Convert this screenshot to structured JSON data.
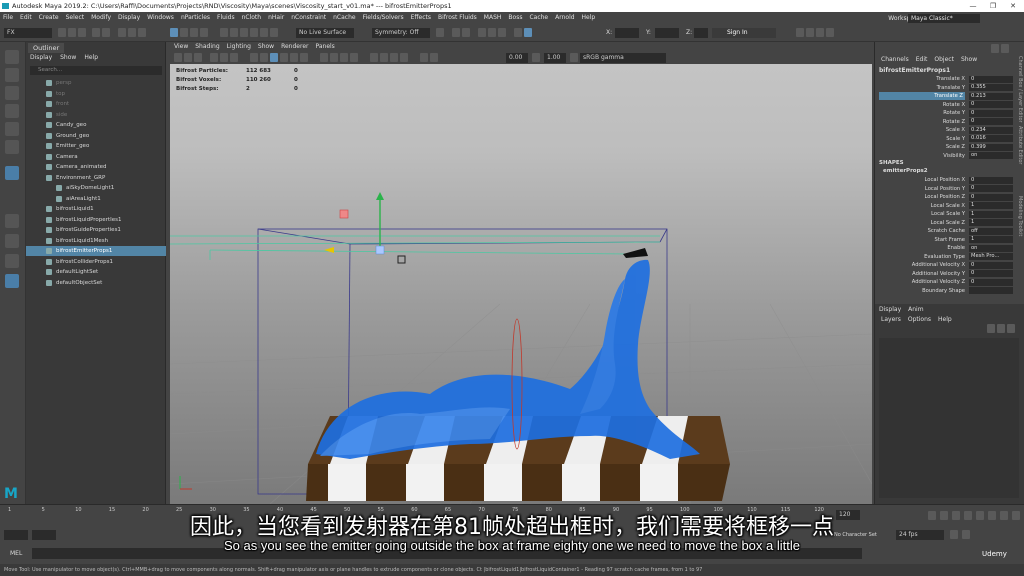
{
  "window": {
    "title": "Autodesk Maya 2019.2: C:\\Users\\Raffi\\Documents\\Projects\\RND\\Viscosity\\Maya\\scenes\\Viscosity_start_v01.ma*    ---    bifrostEmitterProps1"
  },
  "menu": [
    "File",
    "Edit",
    "Create",
    "Select",
    "Modify",
    "Display",
    "Windows",
    "nParticles",
    "Fluids",
    "nCloth",
    "nHair",
    "nConstraint",
    "nCache",
    "Fields/Solvers",
    "Effects",
    "Bifrost Fluids",
    "MASH",
    "Boss",
    "Cache",
    "Arnold",
    "Help"
  ],
  "workspace": {
    "label": "Workspace :",
    "value": "Maya Classic*"
  },
  "status": {
    "mode": "FX",
    "live_surface": "No Live Surface",
    "symmetry": "Symmetry: Off",
    "x": "X:",
    "y": "Y:",
    "z": "Z:",
    "signin": "Sign In"
  },
  "outliner": {
    "tab": "Outliner",
    "menu": [
      "Display",
      "Show",
      "Help"
    ],
    "search": "Search...",
    "items": [
      {
        "label": "persp",
        "dim": true,
        "indent": 0
      },
      {
        "label": "top",
        "dim": true,
        "indent": 0
      },
      {
        "label": "front",
        "dim": true,
        "indent": 0
      },
      {
        "label": "side",
        "dim": true,
        "indent": 0
      },
      {
        "label": "Candy_geo",
        "indent": 0
      },
      {
        "label": "Ground_geo",
        "indent": 0
      },
      {
        "label": "Emitter_geo",
        "indent": 0
      },
      {
        "label": "Camera",
        "indent": 0
      },
      {
        "label": "Camera_animated",
        "indent": 0
      },
      {
        "label": "Environment_GRP",
        "indent": 0
      },
      {
        "label": "aiSkyDomeLight1",
        "indent": 1
      },
      {
        "label": "aiAreaLight1",
        "indent": 1
      },
      {
        "label": "bifrostLiquid1",
        "indent": 0
      },
      {
        "label": "bifrostLiquidPropertIes1",
        "indent": 0
      },
      {
        "label": "bifrostGuideProperties1",
        "indent": 0
      },
      {
        "label": "bifrostLiquid1Mesh",
        "indent": 0
      },
      {
        "label": "bifrostEmitterProps1",
        "indent": 0,
        "selected": true
      },
      {
        "label": "bifrostColliderProps1",
        "indent": 0
      },
      {
        "label": "defaultLightSet",
        "indent": 0
      },
      {
        "label": "defaultObjectSet",
        "indent": 0
      }
    ]
  },
  "panel_menu": [
    "View",
    "Shading",
    "Lighting",
    "Show",
    "Renderer",
    "Panels"
  ],
  "vp_toolbar": {
    "exposure": "0.00",
    "gamma": "1.00",
    "colorspace": "sRGB gamma"
  },
  "hud": [
    {
      "label": "Bifrost Particles:",
      "v1": "112 683",
      "v2": "0"
    },
    {
      "label": "Bifrost Voxels:",
      "v1": "110 260",
      "v2": "0"
    },
    {
      "label": "Bifrost Steps:",
      "v1": "2",
      "v2": "0"
    }
  ],
  "channelbox": {
    "tabs": [
      "Channels",
      "Edit",
      "Object",
      "Show"
    ],
    "node": "bifrostEmitterProps1",
    "channels": [
      {
        "label": "Translate X",
        "value": "0"
      },
      {
        "label": "Translate Y",
        "value": "0.355"
      },
      {
        "label": "Translate Z",
        "value": "0.213",
        "hl": true
      },
      {
        "label": "Rotate X",
        "value": "0"
      },
      {
        "label": "Rotate Y",
        "value": "0"
      },
      {
        "label": "Rotate Z",
        "value": "0"
      },
      {
        "label": "Scale X",
        "value": "0.234"
      },
      {
        "label": "Scale Y",
        "value": "0.016"
      },
      {
        "label": "Scale Z",
        "value": "0.399"
      },
      {
        "label": "Visibility",
        "value": "on"
      }
    ],
    "shapes_header": "SHAPES",
    "shape_node": "emitterProps2",
    "shape_channels": [
      {
        "label": "Local Position X",
        "value": "0"
      },
      {
        "label": "Local Position Y",
        "value": "0"
      },
      {
        "label": "Local Position Z",
        "value": "0"
      },
      {
        "label": "Local Scale X",
        "value": "1"
      },
      {
        "label": "Local Scale Y",
        "value": "1"
      },
      {
        "label": "Local Scale Z",
        "value": "1"
      },
      {
        "label": "Scratch Cache",
        "value": "off"
      },
      {
        "label": "Start Frame",
        "value": "1"
      },
      {
        "label": "Enable",
        "value": "on"
      },
      {
        "label": "Evaluation Type",
        "value": "Mesh Pro..."
      },
      {
        "label": "Additional Velocity X",
        "value": "0"
      },
      {
        "label": "Additional Velocity Y",
        "value": "0"
      },
      {
        "label": "Additional Velocity Z",
        "value": "0"
      },
      {
        "label": "Boundary Shape",
        "value": ""
      }
    ],
    "side_tabs": [
      "Channel Box / Layer Editor",
      "Attribute Editor",
      "Modeling Toolkit"
    ]
  },
  "layers": {
    "tabs": [
      "Display",
      "Anim"
    ],
    "menu": [
      "Layers",
      "Options",
      "Help"
    ]
  },
  "timeline": {
    "ticks": [
      "1",
      "5",
      "10",
      "15",
      "20",
      "25",
      "30",
      "35",
      "40",
      "45",
      "50",
      "55",
      "60",
      "65",
      "70",
      "75",
      "80",
      "85",
      "90",
      "95",
      "100",
      "105",
      "110",
      "115",
      "120"
    ],
    "current": "120",
    "fps": "24 fps",
    "char_set": "No Character Set",
    "anim_layer": "No Anim Layer"
  },
  "mel": {
    "label": "MEL"
  },
  "helpline": "Move Tool: Use manipulator to move object(s). Ctrl+MMB+drag to move components along normals. Shift+drag manipulator axis or plane handles to extrude components or clone objects. Ct  |bifrostLiquid1|bifrostLiquidContainer1 - Reading 97 scratch cache frames, from 1 to 97",
  "subtitle": {
    "cn": "因此，当您看到发射器在第81帧处超出框时，我们需要将框移一点",
    "en": "So as you see the emitter going outside the box at frame eighty one we need to move the box a little"
  },
  "logos": {
    "maya": "M",
    "udemy": "Udemy"
  },
  "colors": {
    "selection": "#5285a6",
    "liquid": "#1e6fe0",
    "candy_dark": "#4a2f14"
  }
}
